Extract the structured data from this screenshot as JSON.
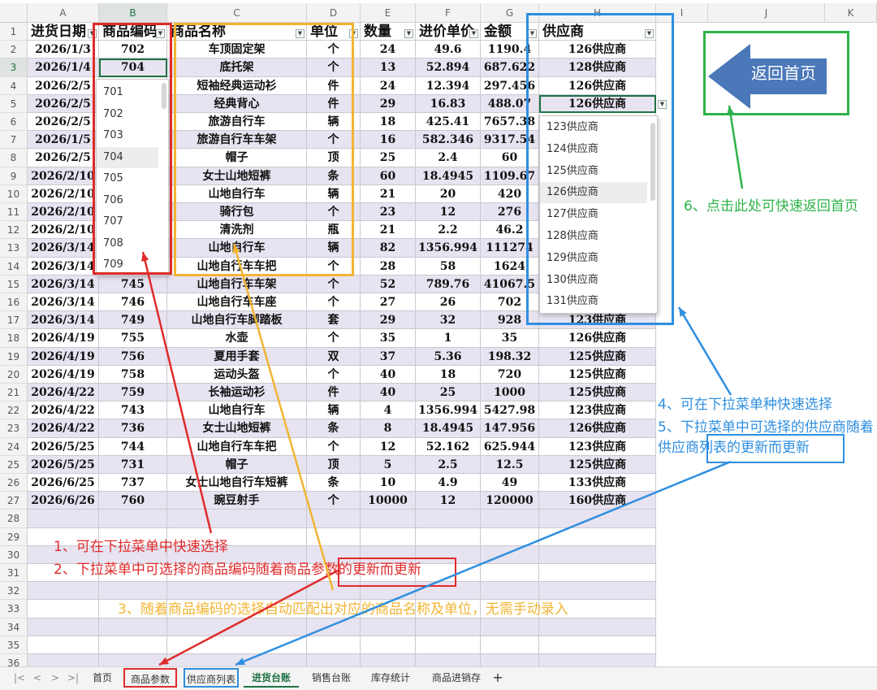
{
  "columns": [
    "A",
    "B",
    "C",
    "D",
    "E",
    "F",
    "G",
    "H",
    "I",
    "J",
    "K"
  ],
  "header_row": [
    "进货日期",
    "商品编码",
    "商品名称",
    "单位",
    "数量",
    "进价单价",
    "金额",
    "供应商"
  ],
  "rows": [
    [
      "2026/1/3",
      "702",
      "车顶固定架",
      "个",
      "24",
      "49.6",
      "1190.4",
      "126供应商"
    ],
    [
      "2026/1/4",
      "704",
      "底托架",
      "个",
      "13",
      "52.894",
      "687.622",
      "128供应商"
    ],
    [
      "2026/2/5",
      "",
      "短袖经典运动衫",
      "件",
      "24",
      "12.394",
      "297.456",
      "126供应商"
    ],
    [
      "2026/2/5",
      "",
      "经典背心",
      "件",
      "29",
      "16.83",
      "488.07",
      "126供应商"
    ],
    [
      "2026/2/5",
      "",
      "旅游自行车",
      "辆",
      "18",
      "425.41",
      "7657.38",
      ""
    ],
    [
      "2026/1/5",
      "",
      "旅游自行车车架",
      "个",
      "16",
      "582.346",
      "9317.54",
      ""
    ],
    [
      "2026/2/5",
      "",
      "帽子",
      "顶",
      "25",
      "2.4",
      "60",
      ""
    ],
    [
      "2026/2/10",
      "",
      "女士山地短裤",
      "条",
      "60",
      "18.4945",
      "1109.67",
      ""
    ],
    [
      "2026/2/10",
      "",
      "山地自行车",
      "辆",
      "21",
      "20",
      "420",
      ""
    ],
    [
      "2026/2/10",
      "",
      "骑行包",
      "个",
      "23",
      "12",
      "276",
      ""
    ],
    [
      "2026/2/10",
      "",
      "清洗剂",
      "瓶",
      "21",
      "2.2",
      "46.2",
      ""
    ],
    [
      "2026/3/14",
      "",
      "山地自行车",
      "辆",
      "82",
      "1356.994",
      "111274",
      ""
    ],
    [
      "2026/3/14",
      "",
      "山地自行车车把",
      "个",
      "28",
      "58",
      "1624",
      ""
    ],
    [
      "2026/3/14",
      "745",
      "山地自行车车架",
      "个",
      "52",
      "789.76",
      "41067.5",
      ""
    ],
    [
      "2026/3/14",
      "746",
      "山地自行车车座",
      "个",
      "27",
      "26",
      "702",
      ""
    ],
    [
      "2026/3/14",
      "749",
      "山地自行车脚踏板",
      "套",
      "29",
      "32",
      "928",
      "123供应商"
    ],
    [
      "2026/4/19",
      "755",
      "水壶",
      "个",
      "35",
      "1",
      "35",
      "126供应商"
    ],
    [
      "2026/4/19",
      "756",
      "夏用手套",
      "双",
      "37",
      "5.36",
      "198.32",
      "125供应商"
    ],
    [
      "2026/4/19",
      "758",
      "运动头盔",
      "个",
      "40",
      "18",
      "720",
      "125供应商"
    ],
    [
      "2026/4/22",
      "759",
      "长袖运动衫",
      "件",
      "40",
      "25",
      "1000",
      "125供应商"
    ],
    [
      "2026/4/22",
      "743",
      "山地自行车",
      "辆",
      "4",
      "1356.994",
      "5427.98",
      "123供应商"
    ],
    [
      "2026/4/22",
      "736",
      "女士山地短裤",
      "条",
      "8",
      "18.4945",
      "147.956",
      "126供应商"
    ],
    [
      "2026/5/25",
      "744",
      "山地自行车车把",
      "个",
      "12",
      "52.162",
      "625.944",
      "123供应商"
    ],
    [
      "2026/5/25",
      "731",
      "帽子",
      "顶",
      "5",
      "2.5",
      "12.5",
      "125供应商"
    ],
    [
      "2026/6/25",
      "737",
      "女士山地自行车短裤",
      "条",
      "10",
      "4.9",
      "49",
      "133供应商"
    ],
    [
      "2026/6/26",
      "760",
      "豌豆射手",
      "个",
      "10000",
      "12",
      "120000",
      "160供应商"
    ]
  ],
  "row_numbers": [
    "1",
    "2",
    "3",
    "4",
    "5",
    "6",
    "7",
    "8",
    "9",
    "10",
    "11",
    "12",
    "13",
    "14",
    "15",
    "16",
    "17",
    "18",
    "19",
    "20",
    "21",
    "22",
    "23",
    "24",
    "25",
    "26",
    "27",
    "28",
    "29",
    "30",
    "31",
    "32",
    "33",
    "34",
    "35",
    "36"
  ],
  "code_dropdown": [
    "701",
    "702",
    "703",
    "704",
    "705",
    "706",
    "707",
    "708",
    "709"
  ],
  "code_dropdown_selected": "704",
  "supplier_dropdown": [
    "123供应商",
    "124供应商",
    "125供应商",
    "126供应商",
    "127供应商",
    "128供应商",
    "129供应商",
    "130供应商",
    "131供应商"
  ],
  "supplier_dropdown_selected": "126供应商",
  "back_button": "返回首页",
  "notes": {
    "red_1": "1、可在下拉菜单中快速选择",
    "red_2": "2、下拉菜单中可选择的商品编码随着商品参数的更新而更新",
    "yellow_3": "3、随着商品编码的选择自动匹配出对应的商品名称及单位，无需手动录入",
    "blue_4": "4、可在下拉菜单种快速选择",
    "blue_5": "5、下拉菜单中可选择的供应商随着供应商列表的更新而更新",
    "green_6": "6、点击此处可快速返回首页"
  },
  "sheet_tabs": [
    "首页",
    "商品参数",
    "供应商列表",
    "进货台账",
    "销售台账",
    "库存统计",
    "商品进销存"
  ],
  "active_tab": "进货台账",
  "add_sheet": "+",
  "nav_arrows": [
    "|<",
    "<",
    ">",
    ">|"
  ],
  "colors": {
    "band": "#e7e3f0",
    "red": "#e02b2b",
    "yellow": "#f2b533",
    "blue": "#2f8fe0",
    "green": "#2eb34a",
    "accent": "#1f7244",
    "arrow_fill": "#4a78b9"
  }
}
